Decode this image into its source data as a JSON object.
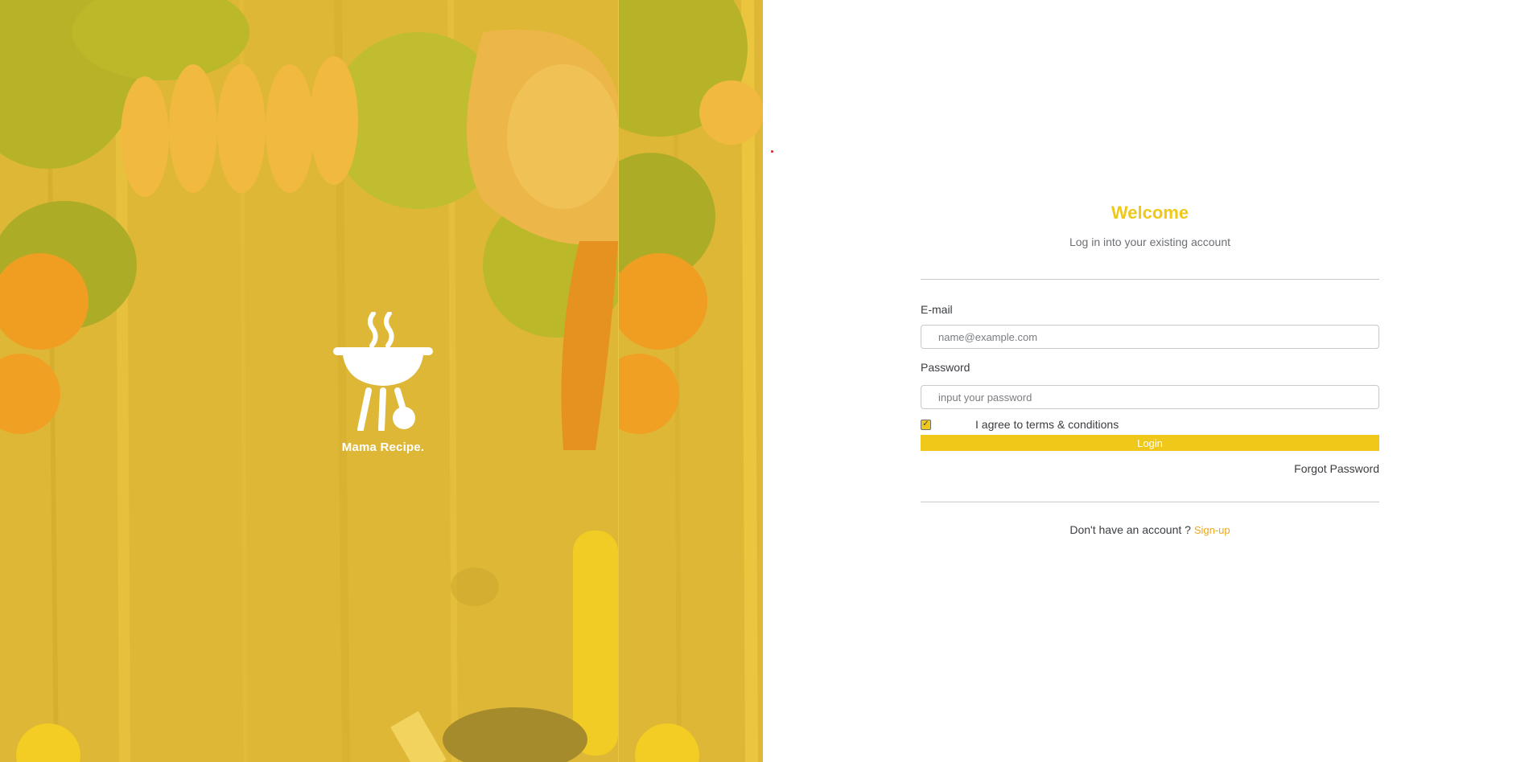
{
  "brand": {
    "name": "Mama Recipe."
  },
  "login": {
    "title": "Welcome",
    "subtitle": "Log in into your existing account",
    "email_label": "E-mail",
    "email_placeholder": "name@example.com",
    "password_label": "Password",
    "password_placeholder": "input your password",
    "agree_label": "I agree to terms & conditions",
    "agree_checked": true,
    "login_button": "Login",
    "forgot_password": "Forgot Password",
    "no_account_text": "Don't have an account ?",
    "signup_link": "Sign-up"
  },
  "colors": {
    "accent": "#efc81a",
    "signup_link": "#efa81a",
    "text": "#3a3d41",
    "muted": "#6b6f74",
    "divider": "#c9c9c9"
  },
  "icons": {
    "logo": "barbecue-grill-icon",
    "checkbox": "checkmark-icon"
  }
}
